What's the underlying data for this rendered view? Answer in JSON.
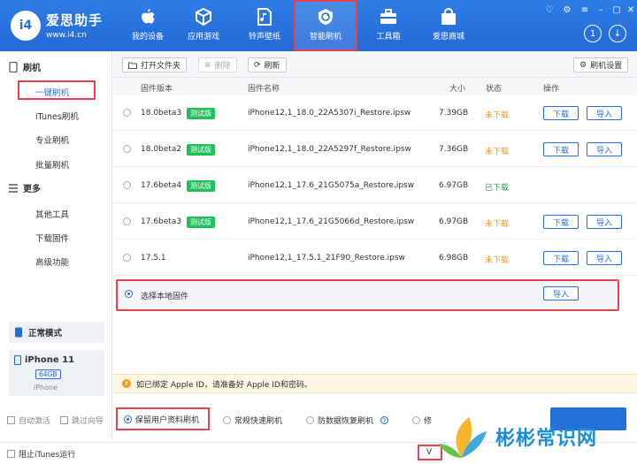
{
  "brand": {
    "logo": "i4",
    "name": "爱思助手",
    "url": "www.i4.cn"
  },
  "nav": [
    {
      "label": "我的设备",
      "icon": "apple-icon"
    },
    {
      "label": "应用游戏",
      "icon": "cube-icon"
    },
    {
      "label": "铃声壁纸",
      "icon": "music-file-icon"
    },
    {
      "label": "智能刷机",
      "icon": "refresh-shield-icon",
      "active": true
    },
    {
      "label": "工具箱",
      "icon": "toolbox-icon"
    },
    {
      "label": "爱思商城",
      "icon": "shopping-bag-icon"
    }
  ],
  "header_right": {
    "badge": "1",
    "download_icon": "download-icon"
  },
  "sidebar": {
    "section1": "刷机",
    "items1": [
      "一键刷机",
      "iTunes刷机",
      "专业刷机",
      "批量刷机"
    ],
    "section2": "更多",
    "items2": [
      "其他工具",
      "下载固件",
      "高级功能"
    ],
    "mode": "正常模式",
    "device_name": "iPhone 11",
    "device_storage": "64GB",
    "device_type": "iPhone"
  },
  "toolbar": {
    "open_folder": "打开文件夹",
    "delete": "删除",
    "refresh": "刷新",
    "settings": "刷机设置"
  },
  "table": {
    "headers": {
      "version": "固件版本",
      "name": "固件名称",
      "size": "大小",
      "status": "状态",
      "action": "操作"
    },
    "rows": [
      {
        "version": "18.0beta3",
        "tag": "测试版",
        "name": "iPhone12,1_18.0_22A5307i_Restore.ipsw",
        "size": "7.39GB",
        "status": "未下载",
        "status_color": "#f09a1a",
        "download": "下载",
        "import": "导入"
      },
      {
        "version": "18.0beta2",
        "tag": "测试版",
        "name": "iPhone12,1_18.0_22A5297f_Restore.ipsw",
        "size": "7.36GB",
        "status": "未下载",
        "status_color": "#f09a1a",
        "download": "下载",
        "import": "导入"
      },
      {
        "version": "17.6beta4",
        "tag": "测试版",
        "name": "iPhone12,1_17.6_21G5075a_Restore.ipsw",
        "size": "6.97GB",
        "status": "已下载",
        "status_color": "#1fa64f",
        "download": "",
        "import": ""
      },
      {
        "version": "17.6beta3",
        "tag": "测试版",
        "name": "iPhone12,1_17.6_21G5066d_Restore.ipsw",
        "size": "6.97GB",
        "status": "未下载",
        "status_color": "#f09a1a",
        "download": "下载",
        "import": "导入"
      },
      {
        "version": "17.5.1",
        "tag": "",
        "name": "iPhone12,1_17.5.1_21F90_Restore.ipsw",
        "size": "6.98GB",
        "status": "未下载",
        "status_color": "#f09a1a",
        "download": "下载",
        "import": "导入"
      }
    ]
  },
  "local": {
    "label": "选择本地固件",
    "import": "导入"
  },
  "notice": "如已绑定 Apple ID，请准备好 Apple ID和密码。",
  "options": {
    "keep_data": "保留用户资料刷机",
    "quick": "常规快速刷机",
    "anti_recovery": "防数据恢复刷机",
    "more": "修"
  },
  "bottom_left": {
    "auto_activate": "自动激活",
    "skip_guide": "跳过向导",
    "block_itunes": "阻止iTunes运行"
  },
  "footer_right": "V",
  "watermark": "彬彬常识网"
}
